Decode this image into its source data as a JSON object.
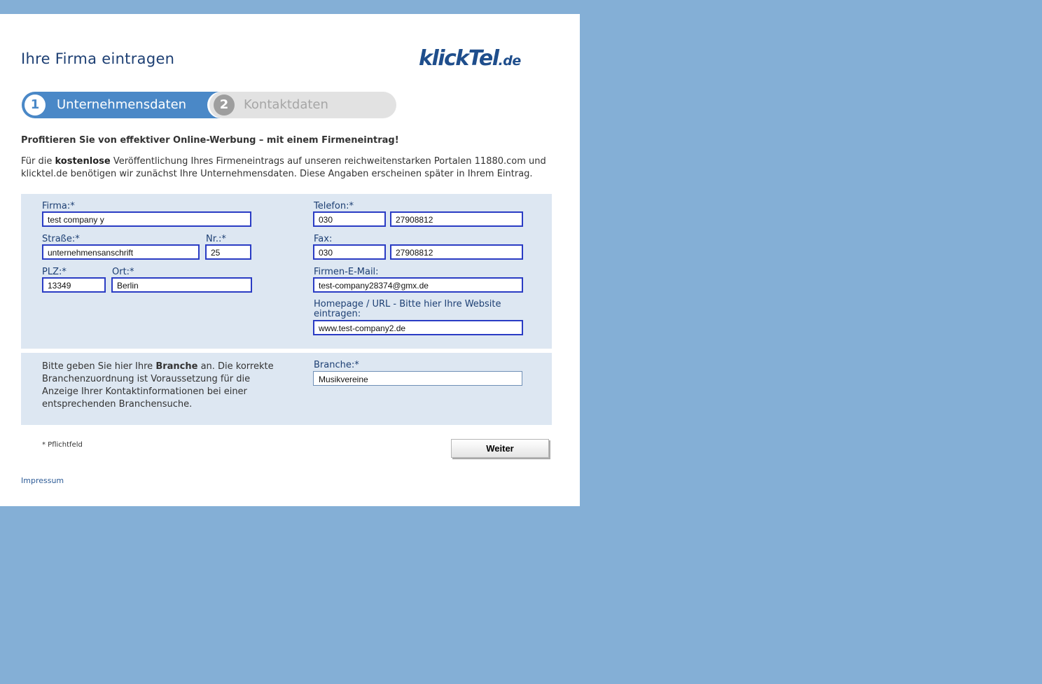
{
  "header": {
    "title": "Ihre Firma eintragen",
    "logo_main": "klick",
    "logo_accent": "Tel",
    "logo_tld": ".de"
  },
  "steps": [
    {
      "number": "1",
      "label": "Unternehmensdaten",
      "active": true
    },
    {
      "number": "2",
      "label": "Kontaktdaten",
      "active": false
    }
  ],
  "intro": {
    "headline": "Profitieren Sie von effektiver Online-Werbung – mit einem Firmeneintrag!",
    "text_before": "Für die ",
    "text_bold": "kostenlose",
    "text_after": " Veröffentlichung Ihres Firmeneintrags auf unseren reichweitenstarken Portalen 11880.com und klicktel.de benötigen wir zunächst Ihre Unternehmensdaten. Diese Angaben erscheinen später in Ihrem Eintrag."
  },
  "form": {
    "firma": {
      "label": "Firma:*",
      "value": "test company y"
    },
    "strasse": {
      "label": "Straße:*",
      "value": "unternehmensanschrift"
    },
    "nr": {
      "label": "Nr.:*",
      "value": "25"
    },
    "plz": {
      "label": "PLZ:*",
      "value": "13349"
    },
    "ort": {
      "label": "Ort:*",
      "value": "Berlin"
    },
    "telefon": {
      "label": "Telefon:*",
      "prefix": "030",
      "number": "27908812"
    },
    "fax": {
      "label": "Fax:",
      "prefix": "030",
      "number": "27908812"
    },
    "email": {
      "label": "Firmen-E-Mail:",
      "value": "test-company28374@gmx.de"
    },
    "homepage": {
      "label": "Homepage / URL - Bitte hier Ihre Website eintragen:",
      "value": "www.test-company2.de"
    }
  },
  "branche": {
    "text_before": "Bitte geben Sie hier Ihre ",
    "text_bold": "Branche",
    "text_after": " an. Die korrekte Branchenzuordnung ist Voraussetzung für die Anzeige Ihrer Kontaktinformationen bei einer entsprechenden Branchensuche.",
    "label": "Branche:*",
    "value": "Musikvereine"
  },
  "footer": {
    "required_note": "* Pflichtfeld",
    "submit_label": "Weiter",
    "impressum": "Impressum"
  },
  "colors": {
    "background": "#84afd6",
    "accent": "#4a88c7",
    "form_box": "#dde7f2",
    "label": "#1d3f73"
  }
}
